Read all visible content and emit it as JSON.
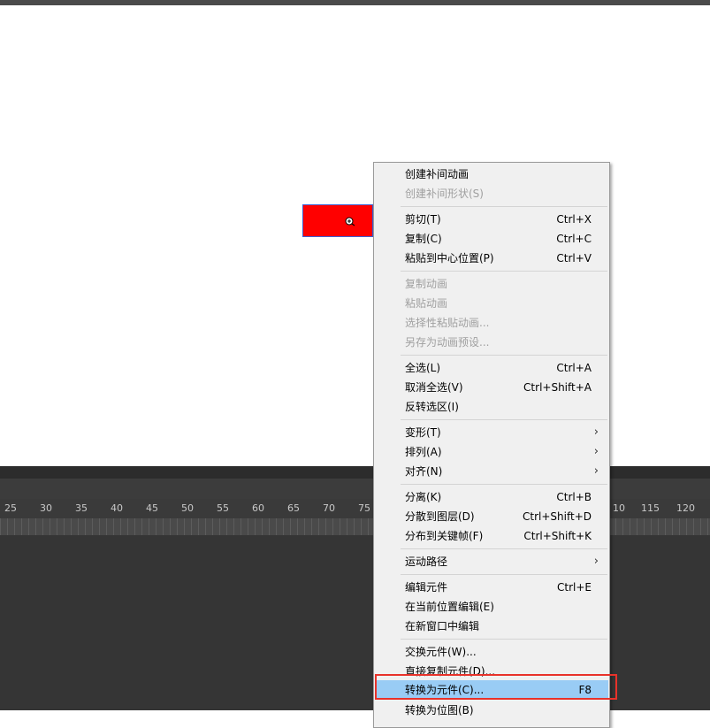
{
  "ruler": {
    "numbers": [
      "25",
      "30",
      "35",
      "40",
      "45",
      "50",
      "55",
      "60",
      "65",
      "70",
      "75",
      "10",
      "115",
      "120"
    ]
  },
  "menu": {
    "items": [
      {
        "label": "创建补间动画",
        "shortcut": "",
        "enabled": true
      },
      {
        "label": "创建补间形状(S)",
        "shortcut": "",
        "enabled": false
      },
      {
        "label": "剪切(T)",
        "shortcut": "Ctrl+X",
        "enabled": true
      },
      {
        "label": "复制(C)",
        "shortcut": "Ctrl+C",
        "enabled": true
      },
      {
        "label": "粘贴到中心位置(P)",
        "shortcut": "Ctrl+V",
        "enabled": true
      },
      {
        "label": "复制动画",
        "shortcut": "",
        "enabled": false
      },
      {
        "label": "粘贴动画",
        "shortcut": "",
        "enabled": false
      },
      {
        "label": "选择性粘贴动画...",
        "shortcut": "",
        "enabled": false
      },
      {
        "label": "另存为动画预设...",
        "shortcut": "",
        "enabled": false
      },
      {
        "label": "全选(L)",
        "shortcut": "Ctrl+A",
        "enabled": true
      },
      {
        "label": "取消全选(V)",
        "shortcut": "Ctrl+Shift+A",
        "enabled": true
      },
      {
        "label": "反转选区(I)",
        "shortcut": "",
        "enabled": true
      },
      {
        "label": "变形(T)",
        "shortcut": "",
        "enabled": true,
        "submenu": true
      },
      {
        "label": "排列(A)",
        "shortcut": "",
        "enabled": true,
        "submenu": true
      },
      {
        "label": "对齐(N)",
        "shortcut": "",
        "enabled": true,
        "submenu": true
      },
      {
        "label": "分离(K)",
        "shortcut": "Ctrl+B",
        "enabled": true
      },
      {
        "label": "分散到图层(D)",
        "shortcut": "Ctrl+Shift+D",
        "enabled": true
      },
      {
        "label": "分布到关键帧(F)",
        "shortcut": "Ctrl+Shift+K",
        "enabled": true
      },
      {
        "label": "运动路径",
        "shortcut": "",
        "enabled": true,
        "submenu": true
      },
      {
        "label": "编辑元件",
        "shortcut": "Ctrl+E",
        "enabled": true
      },
      {
        "label": "在当前位置编辑(E)",
        "shortcut": "",
        "enabled": true
      },
      {
        "label": "在新窗口中编辑",
        "shortcut": "",
        "enabled": true
      },
      {
        "label": "交换元件(W)...",
        "shortcut": "",
        "enabled": true
      },
      {
        "label": "直接复制元件(D)...",
        "shortcut": "",
        "enabled": true
      },
      {
        "label": "转换为元件(C)...",
        "shortcut": "F8",
        "enabled": true,
        "highlighted": true
      },
      {
        "label": "转换为位图(B)",
        "shortcut": "",
        "enabled": true
      }
    ],
    "submenu_arrow": "›"
  },
  "colors": {
    "menu_highlight": "#99ccf5",
    "annotation_box": "#e8322a",
    "shape_fill": "#ff0000",
    "disabled_text": "#a0a0a0"
  },
  "icons": {
    "cursor": "move-cursor-icon",
    "submenu": "chevron-right-icon"
  }
}
